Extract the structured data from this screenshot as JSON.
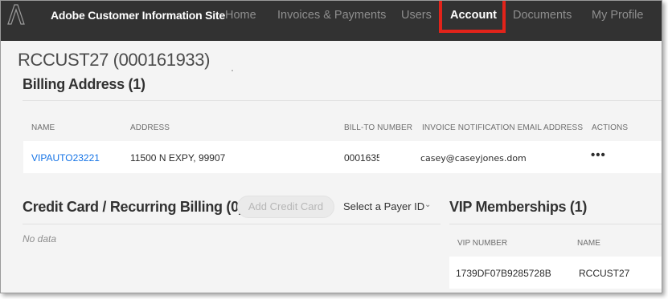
{
  "nav": {
    "site_title": "Adobe Customer Information Site",
    "items": [
      "Home",
      "Invoices & Payments",
      "Users",
      "Account",
      "Documents",
      "My Profile"
    ],
    "active": "Account",
    "highlight_color": "#e2231a"
  },
  "page": {
    "title": "RCCUST27 (000161933)"
  },
  "billing": {
    "heading": "Billing Address (1)",
    "columns": [
      "NAME",
      "ADDRESS",
      "BILL-TO NUMBER",
      "INVOICE NOTIFICATION EMAIL ADDRESS",
      "ACTIONS"
    ],
    "rows": [
      {
        "name": "VIPAUTO23221",
        "address": "11500 N EXPY,  99907",
        "bill_to": "0001635",
        "email": "casey@caseyjones.dom",
        "actions": "•••"
      }
    ]
  },
  "credit": {
    "heading": "Credit Card / Recurring Billing (0)",
    "add_button": "Add Credit Card",
    "payer_select": "Select a Payer ID",
    "empty_text": "No data"
  },
  "vip": {
    "heading": "VIP Memberships (1)",
    "columns": [
      "VIP NUMBER",
      "NAME"
    ],
    "rows": [
      {
        "vip_number": "1739DF07B9285728B",
        "name": "RCCUST27"
      }
    ]
  },
  "icons": {
    "logo": "adobe-logo-icon",
    "actions": "more-icon",
    "select": "chevron-down-icon"
  }
}
